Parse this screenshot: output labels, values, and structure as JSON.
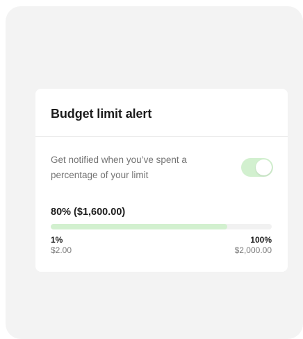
{
  "card": {
    "title": "Budget limit alert",
    "description": "Get notified when you’ve spent a percentage of your limit",
    "toggle_on": true
  },
  "limit": {
    "current_label": "80% ($1,600.00)",
    "fraction": 0.8,
    "min_percent": "1%",
    "min_amount": "$2.00",
    "max_percent": "100%",
    "max_amount": "$2,000.00"
  },
  "colors": {
    "accent": "#d2f0cf",
    "track": "#f1f1f1",
    "background": "#f3f3f3"
  }
}
